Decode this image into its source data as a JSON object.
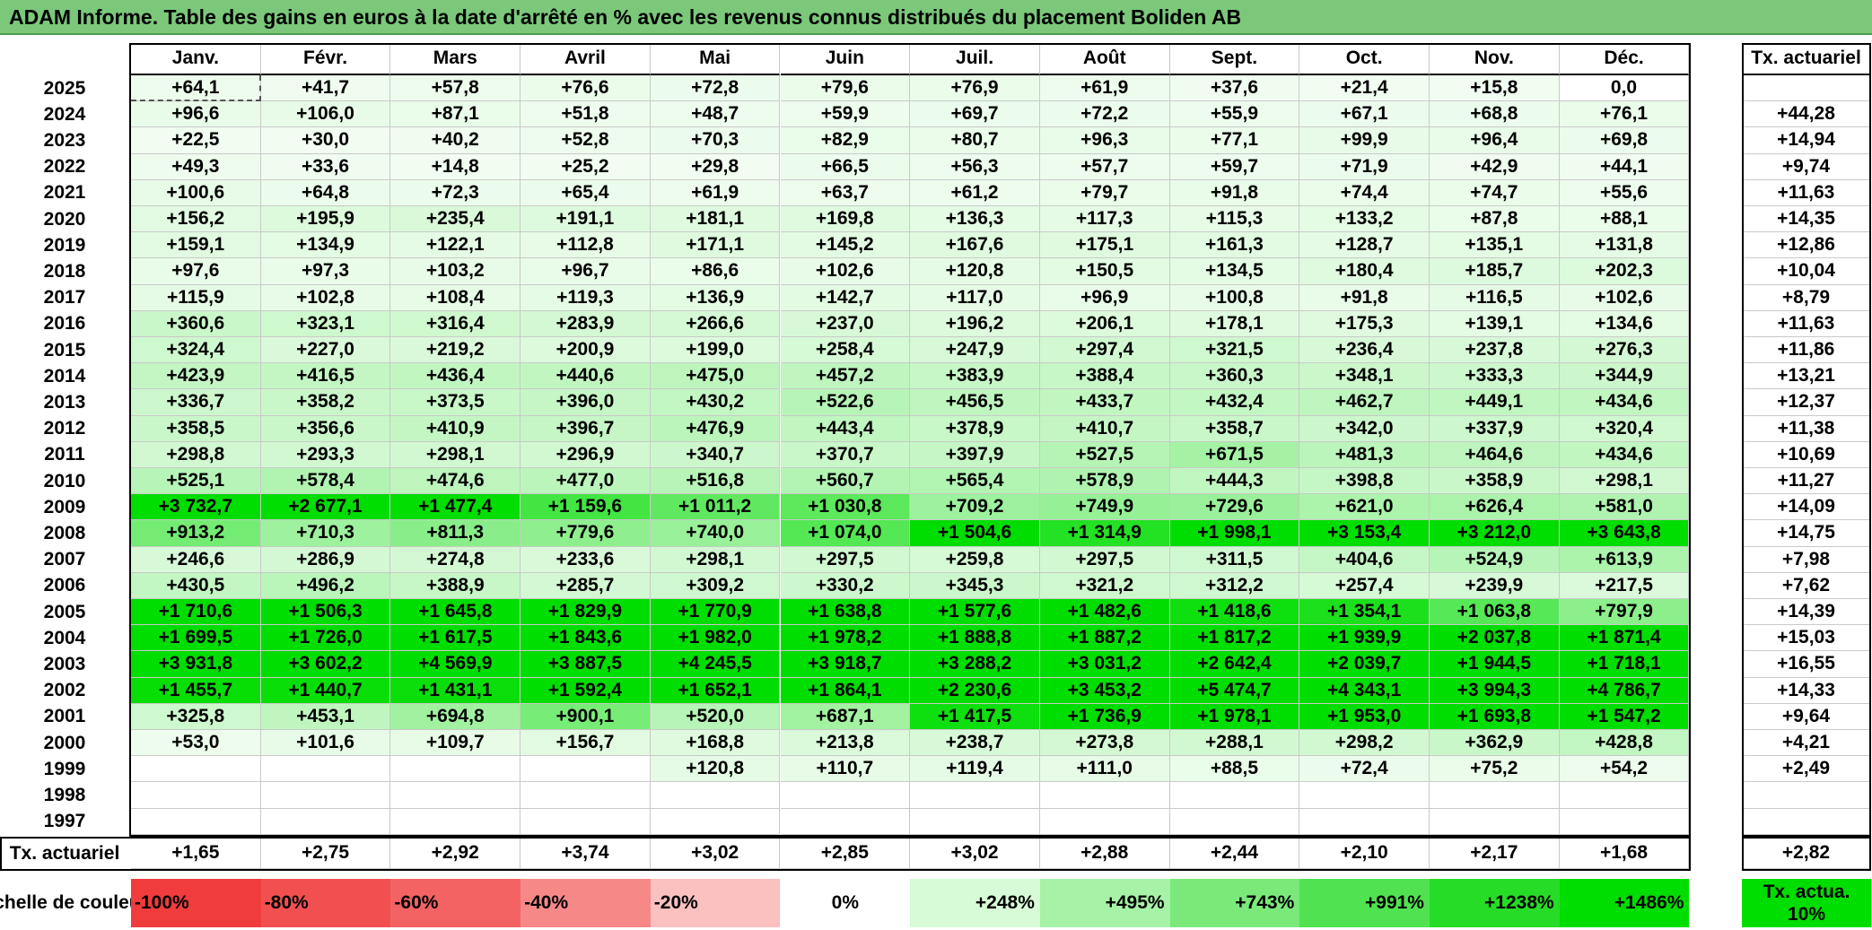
{
  "title": "ADAM Informe. Table des gains en euros à la date d'arrêté en % avec les revenus connus distribués du placement Boliden AB",
  "colors": {
    "title_bg": "#7bc87b",
    "neg_strong": "#f03c3c",
    "pos_strong": "#00dd00"
  },
  "chart_data": {
    "type": "heatmap",
    "columns": [
      "Janv.",
      "Févr.",
      "Mars",
      "Avril",
      "Mai",
      "Juin",
      "Juil.",
      "Août",
      "Sept.",
      "Oct.",
      "Nov.",
      "Déc."
    ],
    "tx_header": "Tx. actuariel",
    "rows": [
      {
        "year": "2025",
        "values": [
          "+64,1",
          "+41,7",
          "+57,8",
          "+76,6",
          "+72,8",
          "+79,6",
          "+76,9",
          "+61,9",
          "+37,6",
          "+21,4",
          "+15,8",
          "0,0"
        ],
        "tx": ""
      },
      {
        "year": "2024",
        "values": [
          "+96,6",
          "+106,0",
          "+87,1",
          "+51,8",
          "+48,7",
          "+59,9",
          "+69,7",
          "+72,2",
          "+55,9",
          "+67,1",
          "+68,8",
          "+76,1"
        ],
        "tx": "+44,28"
      },
      {
        "year": "2023",
        "values": [
          "+22,5",
          "+30,0",
          "+40,2",
          "+52,8",
          "+70,3",
          "+82,9",
          "+80,7",
          "+96,3",
          "+77,1",
          "+99,9",
          "+96,4",
          "+69,8"
        ],
        "tx": "+14,94"
      },
      {
        "year": "2022",
        "values": [
          "+49,3",
          "+33,6",
          "+14,8",
          "+25,2",
          "+29,8",
          "+66,5",
          "+56,3",
          "+57,7",
          "+59,7",
          "+71,9",
          "+42,9",
          "+44,1"
        ],
        "tx": "+9,74"
      },
      {
        "year": "2021",
        "values": [
          "+100,6",
          "+64,8",
          "+72,3",
          "+65,4",
          "+61,9",
          "+63,7",
          "+61,2",
          "+79,7",
          "+91,8",
          "+74,4",
          "+74,7",
          "+55,6"
        ],
        "tx": "+11,63"
      },
      {
        "year": "2020",
        "values": [
          "+156,2",
          "+195,9",
          "+235,4",
          "+191,1",
          "+181,1",
          "+169,8",
          "+136,3",
          "+117,3",
          "+115,3",
          "+133,2",
          "+87,8",
          "+88,1"
        ],
        "tx": "+14,35"
      },
      {
        "year": "2019",
        "values": [
          "+159,1",
          "+134,9",
          "+122,1",
          "+112,8",
          "+171,1",
          "+145,2",
          "+167,6",
          "+175,1",
          "+161,3",
          "+128,7",
          "+135,1",
          "+131,8"
        ],
        "tx": "+12,86"
      },
      {
        "year": "2018",
        "values": [
          "+97,6",
          "+97,3",
          "+103,2",
          "+96,7",
          "+86,6",
          "+102,6",
          "+120,8",
          "+150,5",
          "+134,5",
          "+180,4",
          "+185,7",
          "+202,3"
        ],
        "tx": "+10,04"
      },
      {
        "year": "2017",
        "values": [
          "+115,9",
          "+102,8",
          "+108,4",
          "+119,3",
          "+136,9",
          "+142,7",
          "+117,0",
          "+96,9",
          "+100,8",
          "+91,8",
          "+116,5",
          "+102,6"
        ],
        "tx": "+8,79"
      },
      {
        "year": "2016",
        "values": [
          "+360,6",
          "+323,1",
          "+316,4",
          "+283,9",
          "+266,6",
          "+237,0",
          "+196,2",
          "+206,1",
          "+178,1",
          "+175,3",
          "+139,1",
          "+134,6"
        ],
        "tx": "+11,63"
      },
      {
        "year": "2015",
        "values": [
          "+324,4",
          "+227,0",
          "+219,2",
          "+200,9",
          "+199,0",
          "+258,4",
          "+247,9",
          "+297,4",
          "+321,5",
          "+236,4",
          "+237,8",
          "+276,3"
        ],
        "tx": "+11,86"
      },
      {
        "year": "2014",
        "values": [
          "+423,9",
          "+416,5",
          "+436,4",
          "+440,6",
          "+475,0",
          "+457,2",
          "+383,9",
          "+388,4",
          "+360,3",
          "+348,1",
          "+333,3",
          "+344,9"
        ],
        "tx": "+13,21"
      },
      {
        "year": "2013",
        "values": [
          "+336,7",
          "+358,2",
          "+373,5",
          "+396,0",
          "+430,2",
          "+522,6",
          "+456,5",
          "+433,7",
          "+432,4",
          "+462,7",
          "+449,1",
          "+434,6"
        ],
        "tx": "+12,37"
      },
      {
        "year": "2012",
        "values": [
          "+358,5",
          "+356,6",
          "+410,9",
          "+396,7",
          "+476,9",
          "+443,4",
          "+378,9",
          "+410,7",
          "+358,7",
          "+342,0",
          "+337,9",
          "+320,4"
        ],
        "tx": "+11,38"
      },
      {
        "year": "2011",
        "values": [
          "+298,8",
          "+293,3",
          "+298,1",
          "+296,9",
          "+340,7",
          "+370,7",
          "+397,9",
          "+527,5",
          "+671,5",
          "+481,3",
          "+464,6",
          "+434,6"
        ],
        "tx": "+10,69"
      },
      {
        "year": "2010",
        "values": [
          "+525,1",
          "+578,4",
          "+474,6",
          "+477,0",
          "+516,8",
          "+560,7",
          "+565,4",
          "+578,9",
          "+444,3",
          "+398,8",
          "+358,9",
          "+298,1"
        ],
        "tx": "+11,27"
      },
      {
        "year": "2009",
        "values": [
          "+3 732,7",
          "+2 677,1",
          "+1 477,4",
          "+1 159,6",
          "+1 011,2",
          "+1 030,8",
          "+709,2",
          "+749,9",
          "+729,6",
          "+621,0",
          "+626,4",
          "+581,0"
        ],
        "tx": "+14,09"
      },
      {
        "year": "2008",
        "values": [
          "+913,2",
          "+710,3",
          "+811,3",
          "+779,6",
          "+740,0",
          "+1 074,0",
          "+1 504,6",
          "+1 314,9",
          "+1 998,1",
          "+3 153,4",
          "+3 212,0",
          "+3 643,8"
        ],
        "tx": "+14,75"
      },
      {
        "year": "2007",
        "values": [
          "+246,6",
          "+286,9",
          "+274,8",
          "+233,6",
          "+298,1",
          "+297,5",
          "+259,8",
          "+297,5",
          "+311,5",
          "+404,6",
          "+524,9",
          "+613,9"
        ],
        "tx": "+7,98"
      },
      {
        "year": "2006",
        "values": [
          "+430,5",
          "+496,2",
          "+388,9",
          "+285,7",
          "+309,2",
          "+330,2",
          "+345,3",
          "+321,2",
          "+312,2",
          "+257,4",
          "+239,9",
          "+217,5"
        ],
        "tx": "+7,62"
      },
      {
        "year": "2005",
        "values": [
          "+1 710,6",
          "+1 506,3",
          "+1 645,8",
          "+1 829,9",
          "+1 770,9",
          "+1 638,8",
          "+1 577,6",
          "+1 482,6",
          "+1 418,6",
          "+1 354,1",
          "+1 063,8",
          "+797,9"
        ],
        "tx": "+14,39"
      },
      {
        "year": "2004",
        "values": [
          "+1 699,5",
          "+1 726,0",
          "+1 617,5",
          "+1 843,6",
          "+1 982,0",
          "+1 978,2",
          "+1 888,8",
          "+1 887,2",
          "+1 817,2",
          "+1 939,9",
          "+2 037,8",
          "+1 871,4"
        ],
        "tx": "+15,03"
      },
      {
        "year": "2003",
        "values": [
          "+3 931,8",
          "+3 602,2",
          "+4 569,9",
          "+3 887,5",
          "+4 245,5",
          "+3 918,7",
          "+3 288,2",
          "+3 031,2",
          "+2 642,4",
          "+2 039,7",
          "+1 944,5",
          "+1 718,1"
        ],
        "tx": "+16,55"
      },
      {
        "year": "2002",
        "values": [
          "+1 455,7",
          "+1 440,7",
          "+1 431,1",
          "+1 592,4",
          "+1 652,1",
          "+1 864,1",
          "+2 230,6",
          "+3 453,2",
          "+5 474,7",
          "+4 343,1",
          "+3 994,3",
          "+4 786,7"
        ],
        "tx": "+14,33"
      },
      {
        "year": "2001",
        "values": [
          "+325,8",
          "+453,1",
          "+694,8",
          "+900,1",
          "+520,0",
          "+687,1",
          "+1 417,5",
          "+1 736,9",
          "+1 978,1",
          "+1 953,0",
          "+1 693,8",
          "+1 547,2"
        ],
        "tx": "+9,64"
      },
      {
        "year": "2000",
        "values": [
          "+53,0",
          "+101,6",
          "+109,7",
          "+156,7",
          "+168,8",
          "+213,8",
          "+238,7",
          "+273,8",
          "+288,1",
          "+298,2",
          "+362,9",
          "+428,8"
        ],
        "tx": "+4,21"
      },
      {
        "year": "1999",
        "values": [
          "",
          "",
          "",
          "",
          "+120,8",
          "+110,7",
          "+119,4",
          "+111,0",
          "+88,5",
          "+72,4",
          "+75,2",
          "+54,2"
        ],
        "tx": "+2,49"
      },
      {
        "year": "1998",
        "values": [
          "",
          "",
          "",
          "",
          "",
          "",
          "",
          "",
          "",
          "",
          "",
          ""
        ],
        "tx": ""
      },
      {
        "year": "1997",
        "values": [
          "",
          "",
          "",
          "",
          "",
          "",
          "",
          "",
          "",
          "",
          "",
          ""
        ],
        "tx": ""
      }
    ],
    "footer_row": {
      "label": "Tx. actuariel",
      "values": [
        "+1,65",
        "+2,75",
        "+2,92",
        "+3,74",
        "+3,02",
        "+2,85",
        "+3,02",
        "+2,88",
        "+2,44",
        "+2,10",
        "+2,17",
        "+1,68"
      ],
      "total": "+2,82"
    },
    "scale": {
      "label": "Echelle de couleur",
      "steps": [
        "-100%",
        "-80%",
        "-60%",
        "-40%",
        "-20%",
        "0%",
        "+248%",
        "+495%",
        "+743%",
        "+991%",
        "+1238%",
        "+1486%"
      ],
      "end_label": "Tx. actua. 10%"
    }
  }
}
